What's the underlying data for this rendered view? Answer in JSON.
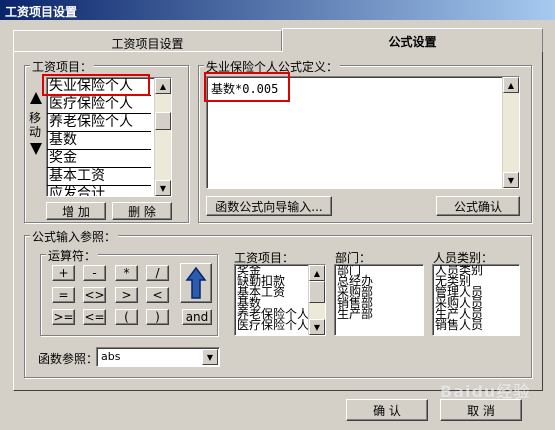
{
  "window": {
    "title": "工资项目设置"
  },
  "tabs": [
    {
      "label": "工资项目设置"
    },
    {
      "label": "公式设置"
    }
  ],
  "salary_items_group": {
    "legend": "工资项目：",
    "items": [
      "失业保险个人",
      "医疗保险个人",
      "养老保险个人",
      "基数",
      "奖金",
      "基本工资",
      "应发合计"
    ],
    "move_label_1": "移",
    "move_label_2": "动",
    "add_button": "增 加",
    "delete_button": "删 除"
  },
  "formula_group": {
    "legend": "失业保险个人公式定义：",
    "formula_text": "基数*0.005",
    "wizard_button": "函数公式向导输入...",
    "confirm_button": "公式确认"
  },
  "formula_input_group": {
    "legend": "公式输入参照：",
    "operators_legend": "运算符：",
    "operators_row1": [
      "+",
      "-",
      "*",
      "/"
    ],
    "operators_row2": [
      "=",
      "<>",
      ">",
      "<"
    ],
    "operators_row3": [
      ">=",
      "<=",
      "(",
      ")"
    ],
    "and_button": "and",
    "salary_items_label": "工资项目：",
    "salary_items": [
      "奖金",
      "缺勤扣款",
      "基本工资",
      "基数",
      "养老保险个人",
      "医疗保险个人"
    ],
    "dept_label": "部门：",
    "departments": [
      "部门",
      "总经办",
      "采购部",
      "销售部",
      "生产部"
    ],
    "staff_label": "人员类别：",
    "staff_categories": [
      "人员类别",
      "无类别",
      "管理人员",
      "采购人员",
      "生产人员",
      "销售人员"
    ],
    "function_label": "函数参照：",
    "function_value": "abs"
  },
  "footer": {
    "ok_button": "确 认",
    "cancel_button": "取 消"
  },
  "watermark": "Baidu经验"
}
